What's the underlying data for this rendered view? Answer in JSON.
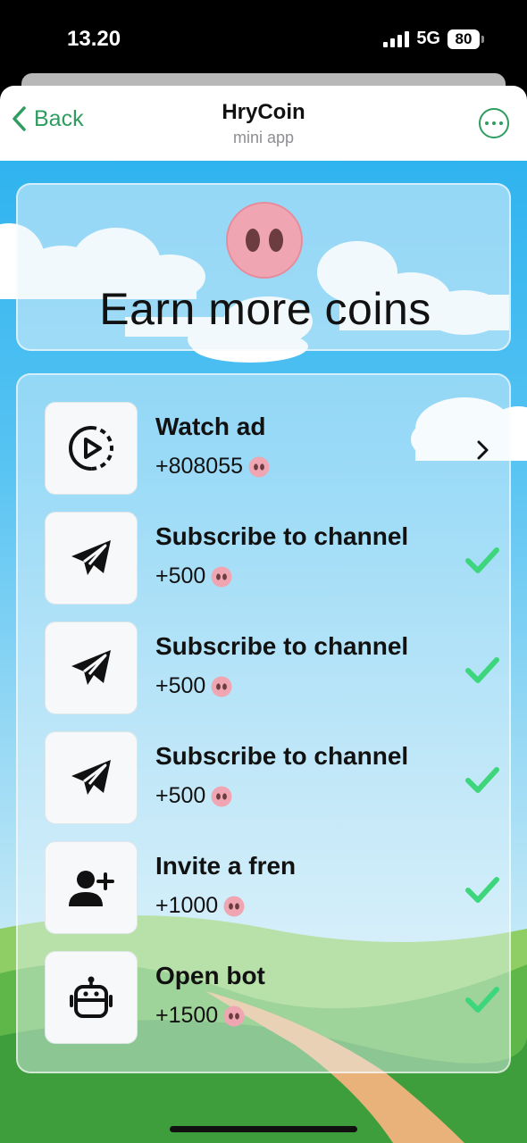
{
  "status_bar": {
    "time": "13.20",
    "network": "5G",
    "battery": "80"
  },
  "nav": {
    "back_label": "Back",
    "title": "HryCoin",
    "subtitle": "mini app"
  },
  "header": {
    "title": "Earn more coins"
  },
  "tasks": [
    {
      "title": "Watch ad",
      "reward": "+808055",
      "icon": "play-circle-icon",
      "status": "chevron"
    },
    {
      "title": "Subscribe to channel",
      "reward": "+500",
      "icon": "telegram-icon",
      "status": "done"
    },
    {
      "title": "Subscribe to channel",
      "reward": "+500",
      "icon": "telegram-icon",
      "status": "done"
    },
    {
      "title": "Subscribe to channel",
      "reward": "+500",
      "icon": "telegram-icon",
      "status": "done"
    },
    {
      "title": "Invite a fren",
      "reward": "+1000",
      "icon": "add-user-icon",
      "status": "done"
    },
    {
      "title": "Open bot",
      "reward": "+1500",
      "icon": "robot-icon",
      "status": "done"
    }
  ],
  "colors": {
    "accent": "#2e9d5f",
    "check": "#3ed67d",
    "coin": "#f0a6b2",
    "sky": "#2fb3ef"
  }
}
